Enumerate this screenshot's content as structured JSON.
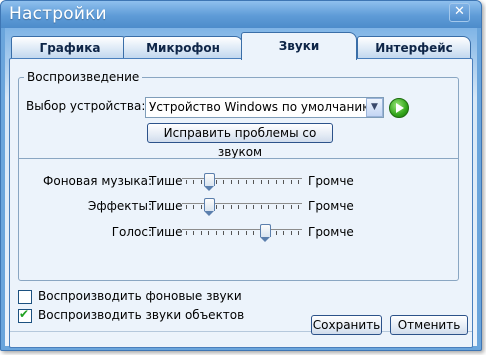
{
  "window": {
    "title": "Настройки"
  },
  "tabs": [
    {
      "label": "Графика"
    },
    {
      "label": "Микрофон"
    },
    {
      "label": "Звуки"
    },
    {
      "label": "Интерфейс"
    }
  ],
  "playback": {
    "legend": "Воспроизведение",
    "device_label": "Выбор устройства:",
    "device_value": "Устройство Windows по умолчанию",
    "fix_button": "Исправить проблемы со звуком"
  },
  "volumes": {
    "quiet": "Тише",
    "loud": "Громче",
    "sliders": [
      {
        "label": "Фоновая музыка:",
        "level": 0.2
      },
      {
        "label": "Эффекты:",
        "level": 0.2
      },
      {
        "label": "Голос:",
        "level": 0.7
      }
    ]
  },
  "options": [
    {
      "label": "Воспроизводить фоновые звуки",
      "checked": false
    },
    {
      "label": "Воспроизводить звуки объектов",
      "checked": true
    }
  ],
  "buttons": {
    "save": "Сохранить",
    "cancel": "Отменить"
  },
  "colors": {
    "title_bar": "#5e9bd7",
    "panel_bg": "#ecf3fb",
    "play_green": "#32a51b"
  }
}
